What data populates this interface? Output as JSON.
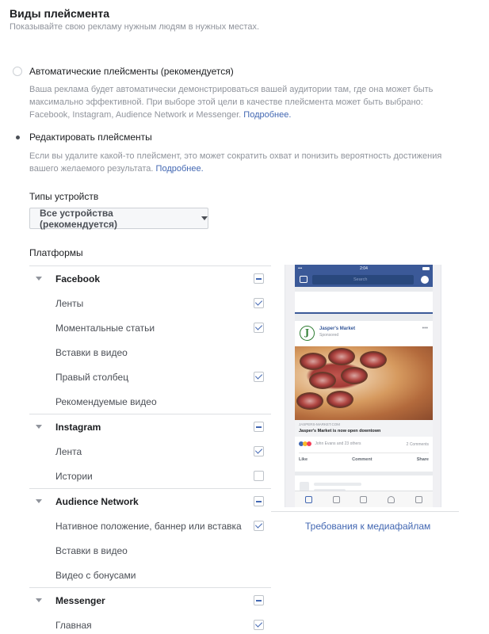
{
  "header": {
    "title": "Виды плейсмента",
    "subtitle": "Показывайте свою рекламу нужным людям в нужных местах."
  },
  "placement_options": {
    "automatic": {
      "label": "Автоматические плейсменты (рекомендуется)",
      "selected": false,
      "desc_line1": "Ваша реклама будет автоматически демонстрироваться вашей аудитории там, где она может быть",
      "desc_line2": "максимально эффективной. При выборе этой цели в качестве плейсмента может быть выбрано:",
      "desc_line3": "Facebook, Instagram, Audience Network и Messenger.",
      "learn_more": "Подробнее."
    },
    "edit": {
      "label": "Редактировать плейсменты",
      "selected": true,
      "desc_line1": "Если вы удалите какой-то плейсмент, это может сократить охват и понизить вероятность достижения",
      "desc_line2": "вашего желаемого результата.",
      "learn_more": "Подробнее."
    }
  },
  "device_types": {
    "label": "Типы устройств",
    "selected": "Все устройства (рекомендуется)"
  },
  "platforms": {
    "label": "Платформы",
    "groups": [
      {
        "name": "Facebook",
        "items": [
          {
            "label": "Ленты",
            "checked": true
          },
          {
            "label": "Моментальные статьи",
            "checked": true
          },
          {
            "label": "Вставки в видео",
            "checked": false
          },
          {
            "label": "Правый столбец",
            "checked": true
          },
          {
            "label": "Рекомендуемые видео",
            "checked": false
          }
        ]
      },
      {
        "name": "Instagram",
        "items": [
          {
            "label": "Лента",
            "checked": true
          },
          {
            "label": "Истории",
            "checked": false
          }
        ]
      },
      {
        "name": "Audience Network",
        "items": [
          {
            "label": "Нативное положение, баннер или вставка",
            "checked": true
          },
          {
            "label": "Вставки в видео",
            "checked": false
          },
          {
            "label": "Видео с бонусами",
            "checked": false
          }
        ]
      },
      {
        "name": "Messenger",
        "items": [
          {
            "label": "Главная",
            "checked": true
          }
        ]
      }
    ]
  },
  "preview": {
    "time": "2:04",
    "search_placeholder": "Search",
    "brand": "Jasper's Market",
    "sponsored": "Sponsored",
    "logo_letter": "J",
    "link_url": "JASPERS-MARKET.COM",
    "link_title": "Jasper's Market is now open downtown",
    "reactions_text": "John Evans and 23 others",
    "comments_text": "2 Comments",
    "like": "Like",
    "comment": "Comment",
    "share": "Share"
  },
  "media_requirements_link": "Требования к медиафайлам",
  "colors": {
    "link": "#4267b2",
    "facebook_blue": "#3b5998",
    "muted_text": "#90949c"
  }
}
